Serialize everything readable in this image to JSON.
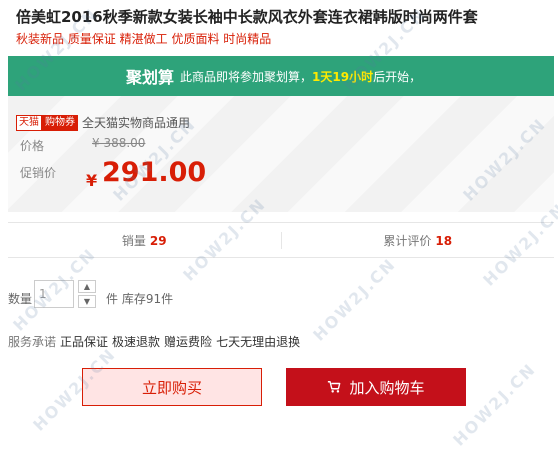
{
  "product": {
    "title": "倍美虹2016秋季新款女装长袖中长款风衣外套连衣裙韩版时尚两件套",
    "subtitle": "秋装新品 质量保证 精湛做工 优质面料 时尚精品"
  },
  "banner": {
    "name": "聚划算",
    "desc": "此商品即将参加聚划算，",
    "time": "1天19小时",
    "tail": "后开始，",
    "color": "#2ea37a"
  },
  "pricing": {
    "tag_tmall": "天猫",
    "tag_coupon": "购物券",
    "coupon_text": "全天猫实物商品通用",
    "price_label": "价格",
    "original_price": "¥ 388.00",
    "promo_label": "促销价",
    "currency": "¥",
    "promo_price": "291.00"
  },
  "stats": {
    "sales_label": "销量",
    "sales_value": "29",
    "reviews_label": "累计评价",
    "reviews_value": "18"
  },
  "quantity": {
    "label": "数量",
    "value": "1",
    "up_icon": "▲",
    "down_icon": "▼",
    "stock_text": "件 库存91件"
  },
  "service": {
    "label": "服务承诺",
    "items": [
      "正品保证",
      "极速退款",
      "赠运费险",
      "七天无理由退换"
    ]
  },
  "actions": {
    "buy_now": "立即购买",
    "add_to_cart": "加入购物车",
    "cart_icon": "cart-icon"
  },
  "watermark": "HOW2J.CN",
  "colors": {
    "accent_red": "#d81e06",
    "cart_button": "#c4101a",
    "banner_green": "#2ea37a"
  }
}
